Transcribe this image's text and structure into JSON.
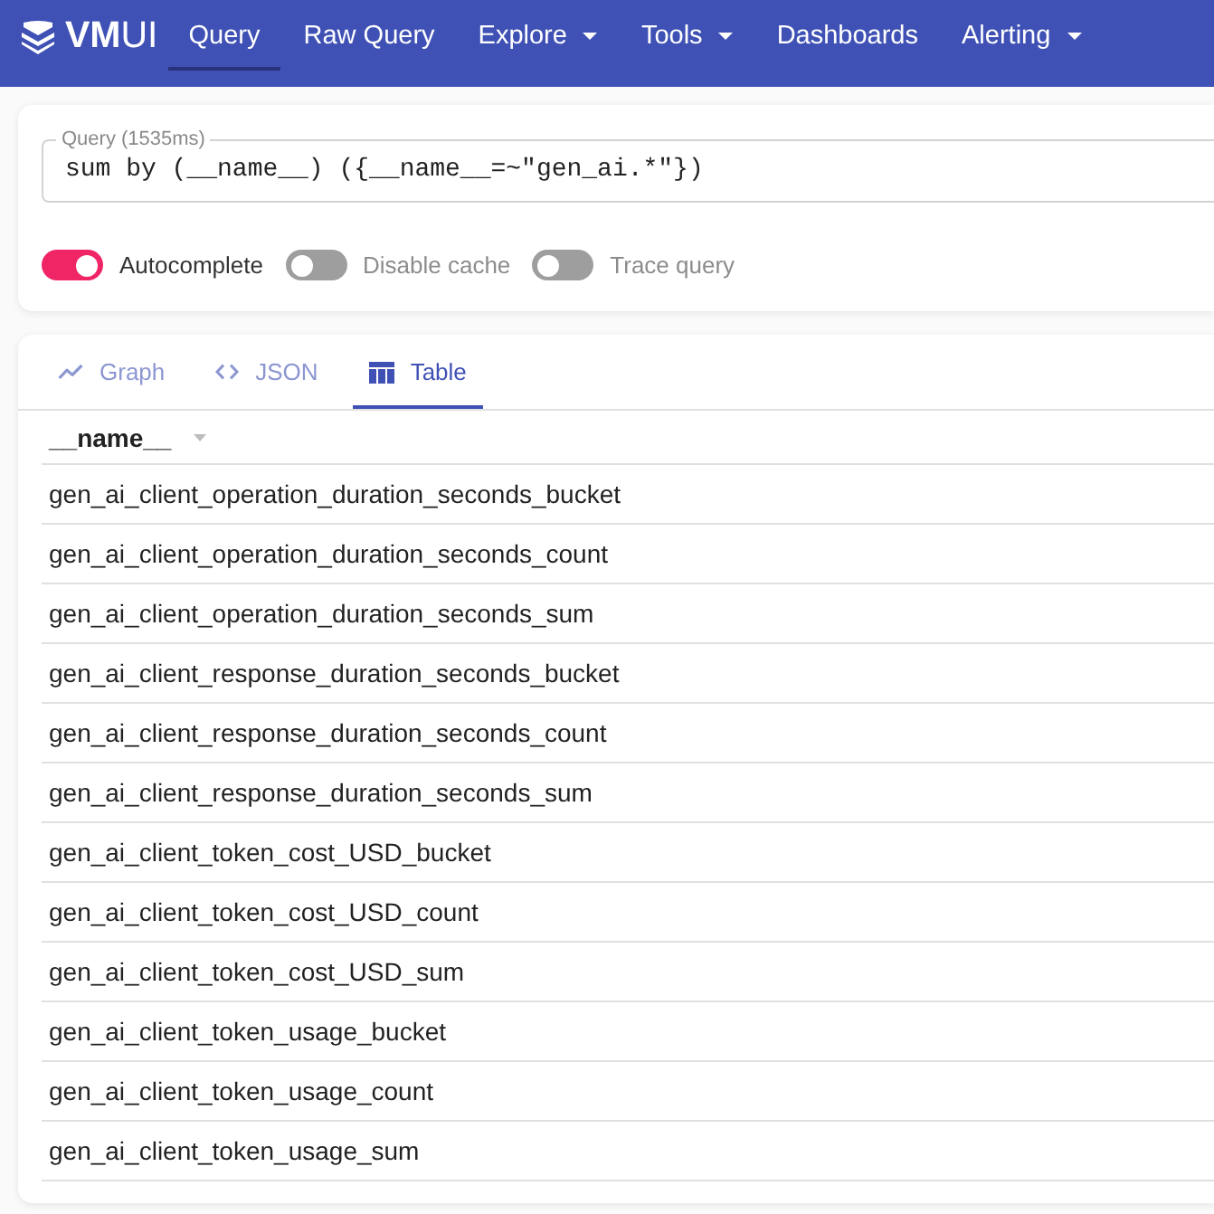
{
  "header": {
    "logo": "**VM**UI",
    "nav": [
      {
        "label": "Query",
        "selected": true,
        "dropdown": false
      },
      {
        "label": "Raw Query",
        "selected": false,
        "dropdown": false
      },
      {
        "label": "Explore",
        "selected": false,
        "dropdown": true
      },
      {
        "label": "Tools",
        "selected": false,
        "dropdown": true
      },
      {
        "label": "Dashboards",
        "selected": false,
        "dropdown": false
      },
      {
        "label": "Alerting",
        "selected": false,
        "dropdown": true
      }
    ]
  },
  "query_panel": {
    "field": {
      "label": "Query (1535ms)",
      "value": "sum by (__name__) ({__name__=~\"gen_ai.*\"})"
    },
    "toggles": [
      {
        "label": "Autocomplete",
        "on": true
      },
      {
        "label": "Disable cache",
        "on": false
      },
      {
        "label": "Trace query",
        "on": false
      }
    ]
  },
  "results": {
    "tabs": [
      {
        "label": "Graph",
        "kind": "graph",
        "selected": false
      },
      {
        "label": "JSON",
        "kind": "code",
        "selected": false
      },
      {
        "label": "Table",
        "kind": "table",
        "selected": true
      }
    ],
    "table": {
      "columns": [
        {
          "label": "__name__",
          "sortable": true
        }
      ],
      "rows": [
        [
          "gen_ai_client_operation_duration_seconds_bucket"
        ],
        [
          "gen_ai_client_operation_duration_seconds_count"
        ],
        [
          "gen_ai_client_operation_duration_seconds_sum"
        ],
        [
          "gen_ai_client_response_duration_seconds_bucket"
        ],
        [
          "gen_ai_client_response_duration_seconds_count"
        ],
        [
          "gen_ai_client_response_duration_seconds_sum"
        ],
        [
          "gen_ai_client_token_cost_USD_bucket"
        ],
        [
          "gen_ai_client_token_cost_USD_count"
        ],
        [
          "gen_ai_client_token_cost_USD_sum"
        ],
        [
          "gen_ai_client_token_usage_bucket"
        ],
        [
          "gen_ai_client_token_usage_count"
        ],
        [
          "gen_ai_client_token_usage_sum"
        ]
      ]
    }
  }
}
